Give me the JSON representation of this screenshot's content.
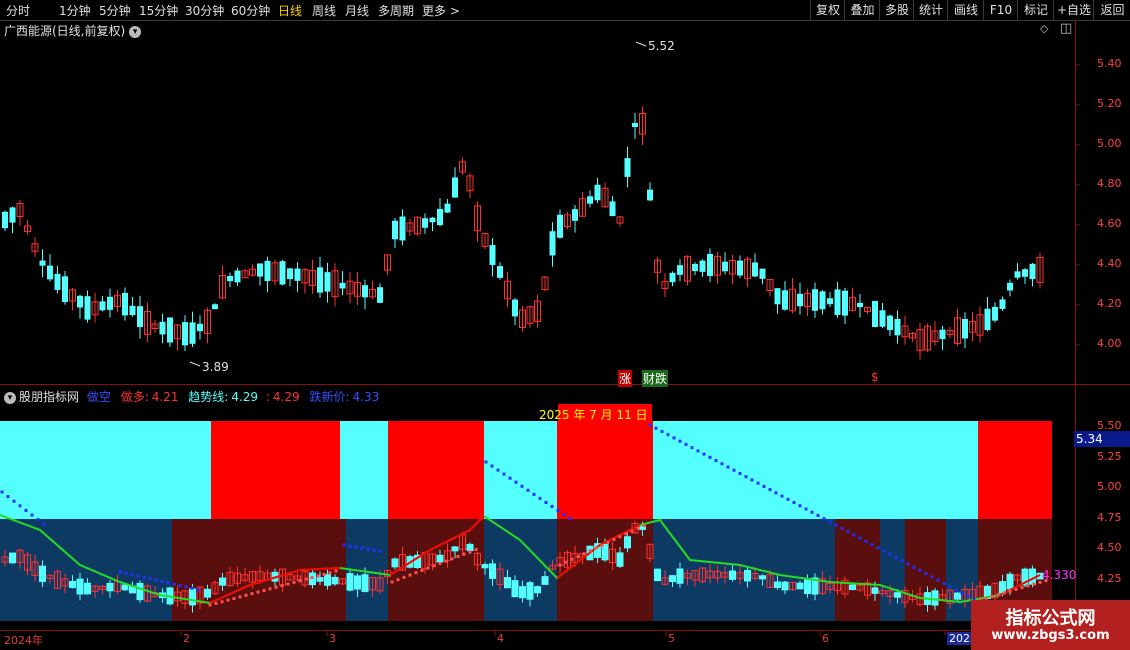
{
  "toolbar": {
    "periods": [
      "分时",
      "1分钟",
      "5分钟",
      "15分钟",
      "30分钟",
      "60分钟",
      "日线",
      "周线",
      "月线",
      "多周期",
      "更多 >"
    ],
    "active_period": "日线",
    "right_buttons": [
      "复权",
      "叠加",
      "多股",
      "统计",
      "画线",
      "F10",
      "标记",
      "+自选",
      "返回"
    ]
  },
  "main_panel": {
    "title": "广西能源(日线,前复权)",
    "high_label": "5.52",
    "low_label": "3.89",
    "y_ticks": [
      "5.40",
      "5.20",
      "5.00",
      "4.80",
      "4.60",
      "4.40",
      "4.20",
      "4.00"
    ],
    "signal_zhang": "涨",
    "signal_caidie": "财跌",
    "signal_s": "$"
  },
  "indicator_panel": {
    "name": "股朋指标网",
    "state": "做空",
    "field1_label": "做多:",
    "field1_value": "4.21",
    "field2_label": "趋势线:",
    "field2_value": "4.29",
    "field3_label": ":",
    "field3_value": "4.29",
    "field4_label": "跌新价:",
    "field4_value": "4.33",
    "date_tip": "2025 年 7 月 11 日",
    "y_ticks": [
      "5.50",
      "5.25",
      "5.00",
      "4.75",
      "4.50",
      "4.25"
    ],
    "price_tag": "5.34",
    "value_tag": "4.330"
  },
  "x_axis": {
    "labels": [
      "2024年",
      "2",
      "3",
      "4",
      "5",
      "6",
      "2025"
    ]
  },
  "watermark": {
    "line1": "指标公式网",
    "line2": "www.zbgs3.com"
  },
  "colors": {
    "up": "#ff3030",
    "down": "#54ffff",
    "red_fill": "#ff0000",
    "cyan_fill": "#54ffff",
    "dark_red": "#5a0e0e",
    "navy": "#0d3a63",
    "trend": "#22dd22",
    "blue_dots": "#2030ff",
    "axis_text": "#ff4040"
  },
  "icons": {
    "diamond": "diamond-icon",
    "square": "square-icon",
    "chevron": "chevron-down-icon"
  }
}
